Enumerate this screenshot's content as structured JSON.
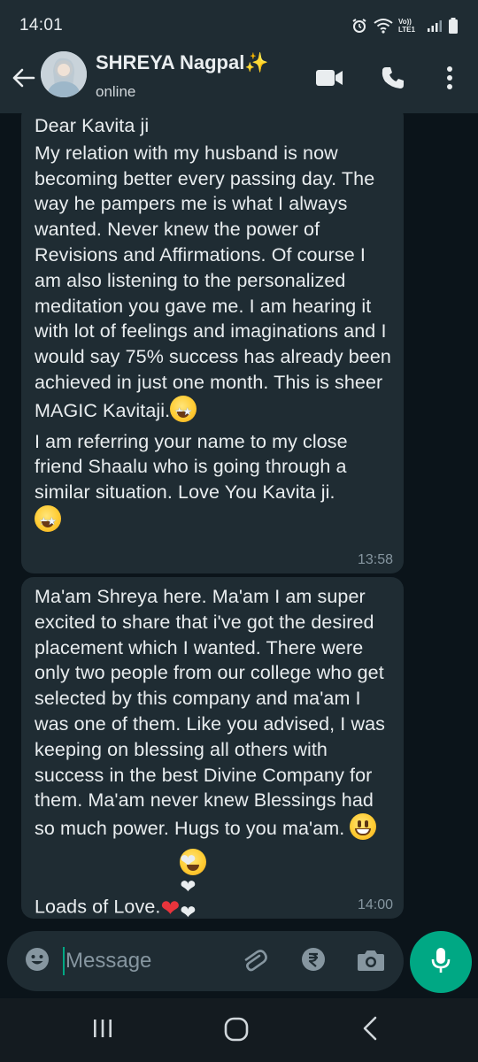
{
  "status_bar": {
    "time": "14:01",
    "network_label": "Vo)) LTE1"
  },
  "header": {
    "contact_name": "SHREYA Nagpal✨",
    "contact_status": "online"
  },
  "messages": [
    {
      "paragraphs": [
        "Dear Kavita ji",
        "My relation with my husband is now becoming better every passing day. The way he pampers me is what I always wanted. Never knew the power of Revisions and Affirmations. Of course I am also listening to the personalized meditation you gave me. I am hearing it with lot of feelings and imaginations and I would say 75% success has already been achieved in just one month. This is sheer MAGIC Kavitaji.",
        "I am referring your name to my close friend Shaalu who is going through a similar situation. Love You Kavita ji."
      ],
      "time": "13:58"
    },
    {
      "paragraphs": [
        "Ma'am Shreya here. Ma'am I am super excited to share that i've got the desired placement which I wanted. There were only two people from our college who get selected by this company and ma'am I was one of them. Like you advised, I was keeping on blessing all others with success in the best Divine Company for them. Ma'am never knew Blessings had so much power. Hugs to you ma'am.",
        "Loads of Love."
      ],
      "time": "14:00"
    }
  ],
  "composer": {
    "placeholder": "Message"
  },
  "icons": {
    "back": "arrow-left-icon",
    "video": "video-camera-icon",
    "call": "phone-icon",
    "menu": "more-vertical-icon",
    "emoji": "emoji-icon",
    "attach": "paperclip-icon",
    "payment": "rupee-icon",
    "camera": "camera-icon",
    "mic": "microphone-icon"
  },
  "colors": {
    "background": "#0b141a",
    "bar": "#1f2c33",
    "bubble": "#1f2c33",
    "accent": "#00a884",
    "text": "#e9edef",
    "muted": "#8696a0"
  }
}
